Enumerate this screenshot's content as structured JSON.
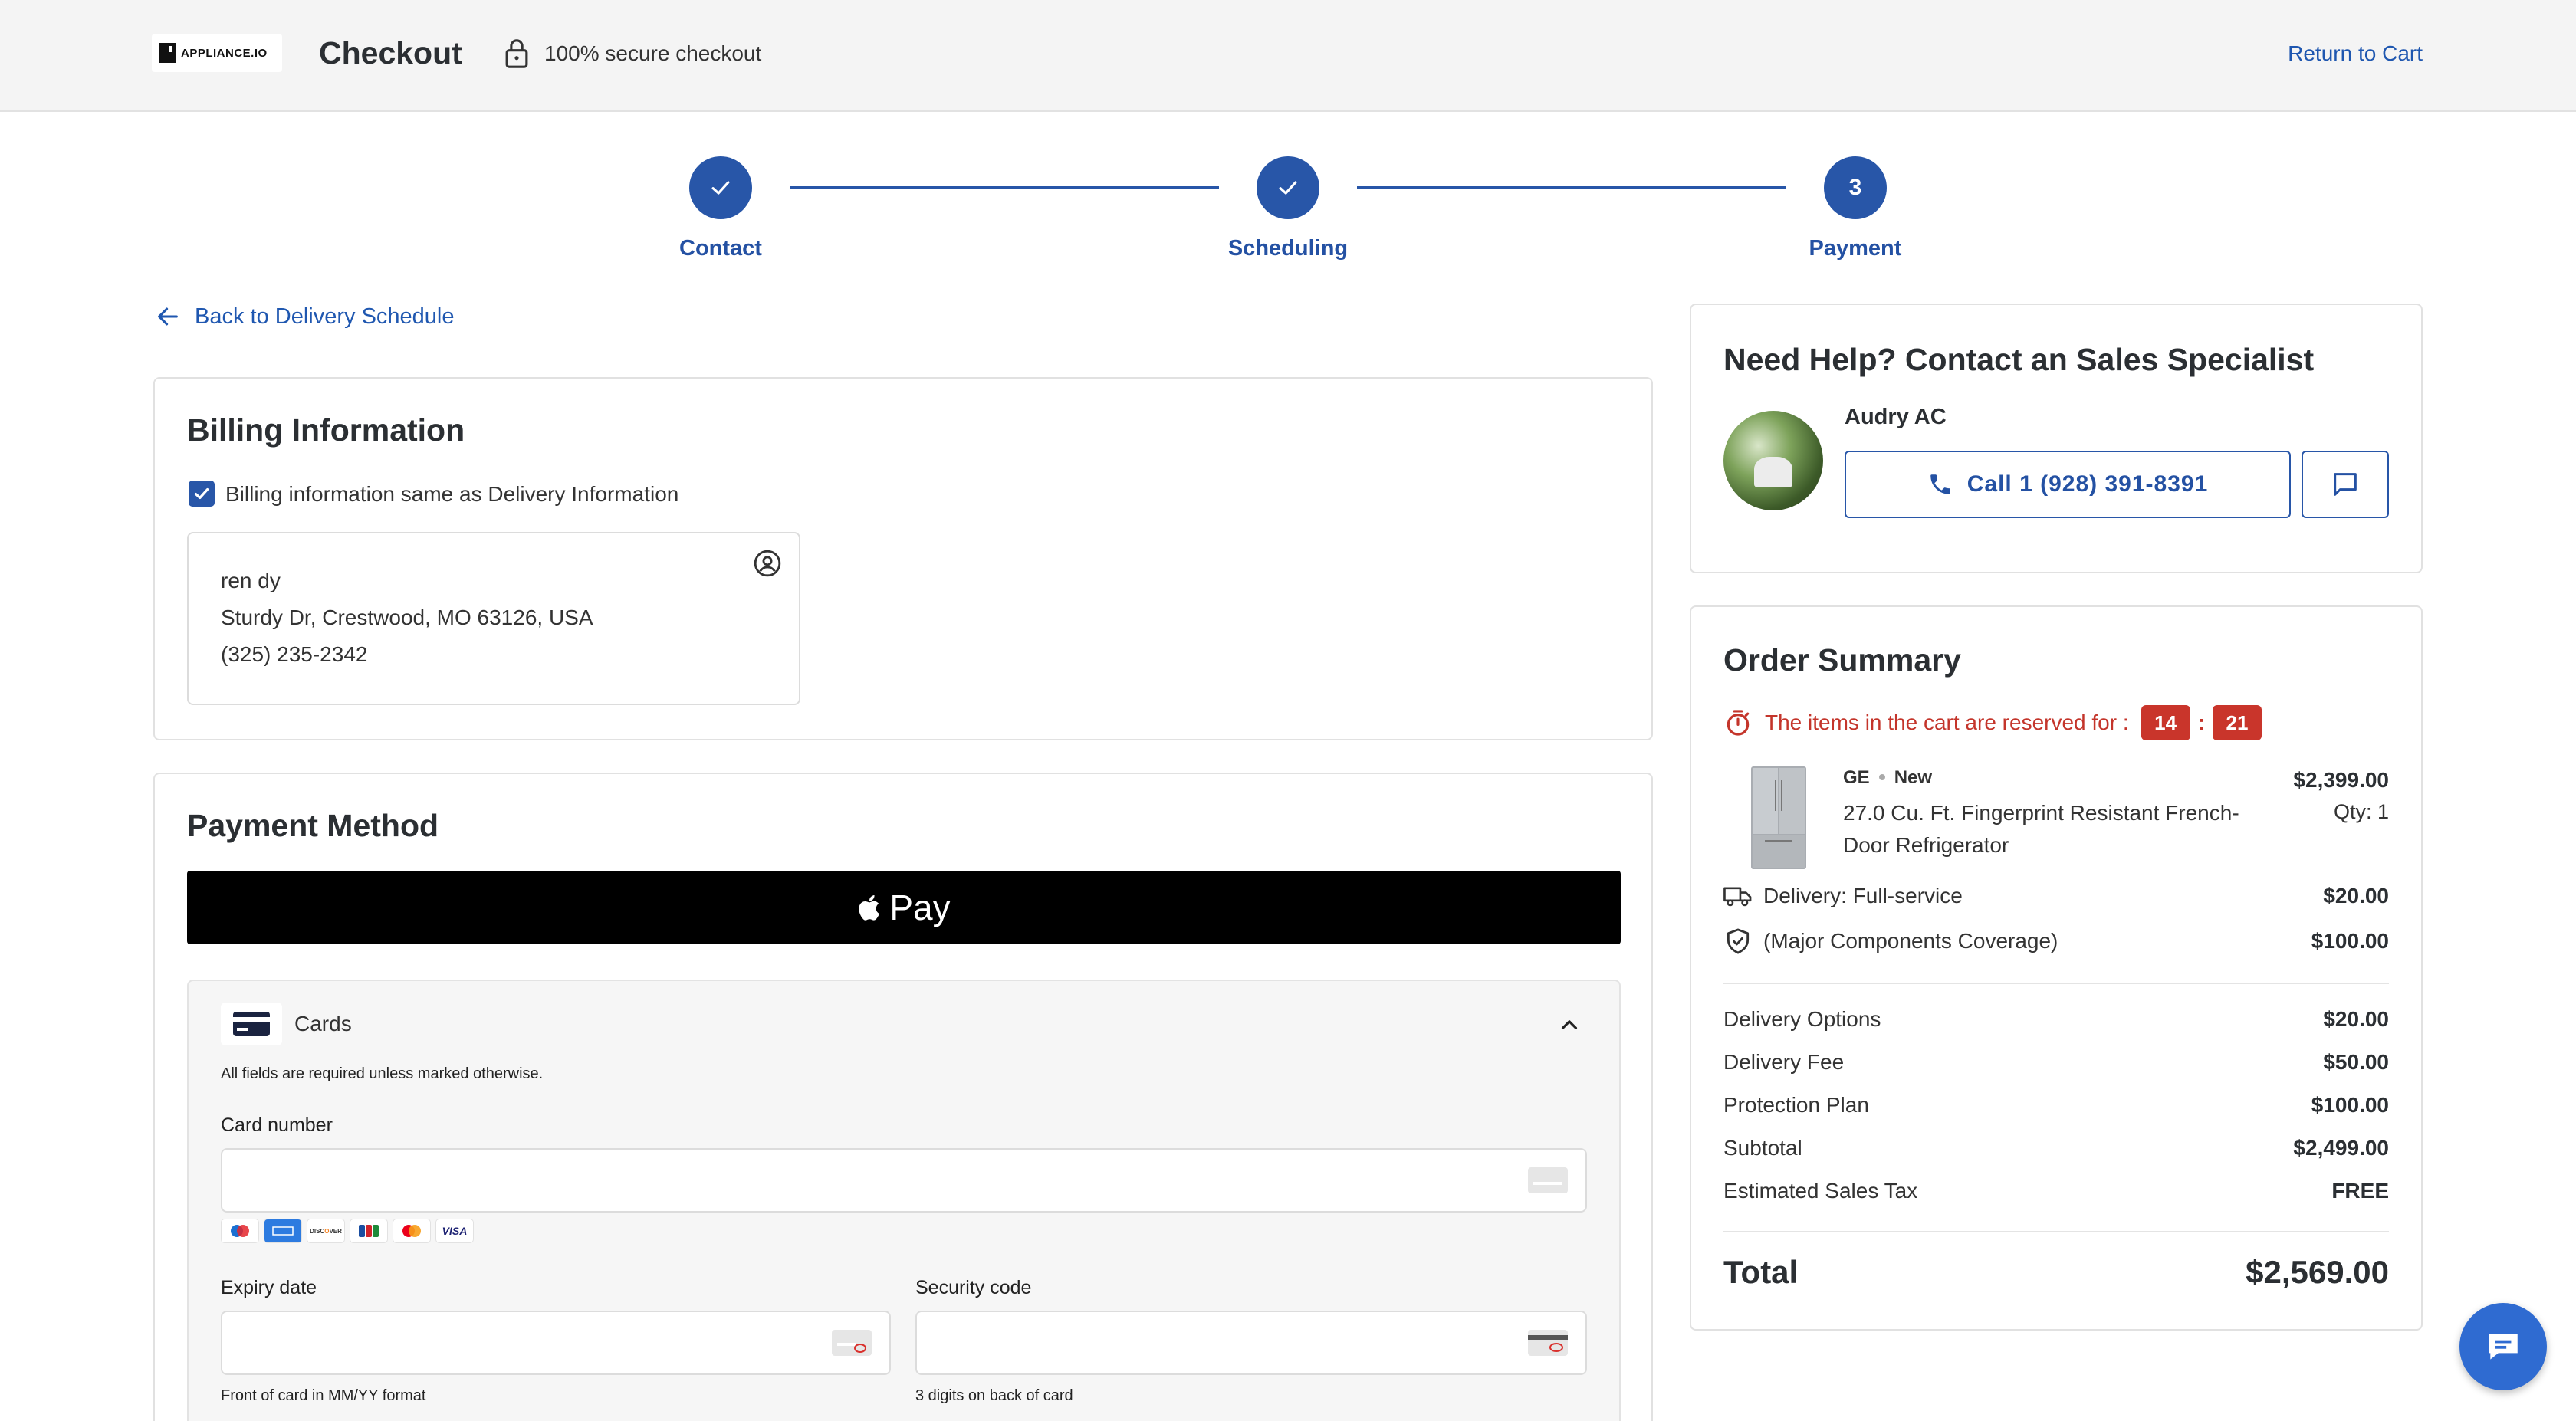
{
  "header": {
    "logo_text": "APPLIANCE.IO",
    "title": "Checkout",
    "secure_text": "100% secure checkout",
    "return_link": "Return to Cart"
  },
  "stepper": {
    "steps": [
      {
        "label": "Contact",
        "state": "done"
      },
      {
        "label": "Scheduling",
        "state": "done"
      },
      {
        "label": "Payment",
        "number": "3",
        "state": "current"
      }
    ]
  },
  "back_link": "Back to Delivery Schedule",
  "billing": {
    "title": "Billing Information",
    "checkbox_label": "Billing information same as Delivery Information",
    "checked": true,
    "address": {
      "name": "ren dy",
      "street": "Sturdy Dr, Crestwood, MO 63126, USA",
      "phone": "(325) 235-2342"
    }
  },
  "payment": {
    "title": "Payment Method",
    "applepay_label": "Pay",
    "cards": {
      "label": "Cards",
      "required_note": "All fields are required unless marked otherwise.",
      "card_number_label": "Card number",
      "card_number_value": "",
      "brands": [
        "Maestro",
        "Amex",
        "Discover",
        "JCB",
        "Mastercard",
        "VISA"
      ],
      "expiry_label": "Expiry date",
      "expiry_value": "",
      "expiry_hint": "Front of card in MM/YY format",
      "cvc_label": "Security code",
      "cvc_value": "",
      "cvc_hint": "3 digits on back of card"
    }
  },
  "help": {
    "title": "Need Help? Contact an Sales Specialist",
    "agent_name": "Audry AC",
    "call_label": "Call 1 (928) 391-8391"
  },
  "order_summary": {
    "title": "Order Summary",
    "reserved_text": "The items in the cart are reserved for :",
    "timer_minutes": "14",
    "timer_seconds": "21",
    "product": {
      "brand": "GE",
      "condition": "New",
      "name": "27.0 Cu. Ft. Fingerprint Resistant French-Door Refrigerator",
      "price": "$2,399.00",
      "qty": "Qty: 1"
    },
    "extras": [
      {
        "label": "Delivery: Full-service",
        "value": "$20.00",
        "icon": "truck-icon"
      },
      {
        "label": "(Major Components Coverage)",
        "value": "$100.00",
        "icon": "shield-check-icon"
      }
    ],
    "lines": [
      {
        "label": "Delivery Options",
        "value": "$20.00"
      },
      {
        "label": "Delivery Fee",
        "value": "$50.00"
      },
      {
        "label": "Protection Plan",
        "value": "$100.00"
      },
      {
        "label": "Subtotal",
        "value": "$2,499.00"
      },
      {
        "label": "Estimated Sales Tax",
        "value": "FREE"
      }
    ],
    "total_label": "Total",
    "total_value": "$2,569.00"
  },
  "colors": {
    "primary": "#2856a8",
    "link": "#1f57b0",
    "alert": "#c9352b",
    "header_bg": "#f4f4f4"
  }
}
